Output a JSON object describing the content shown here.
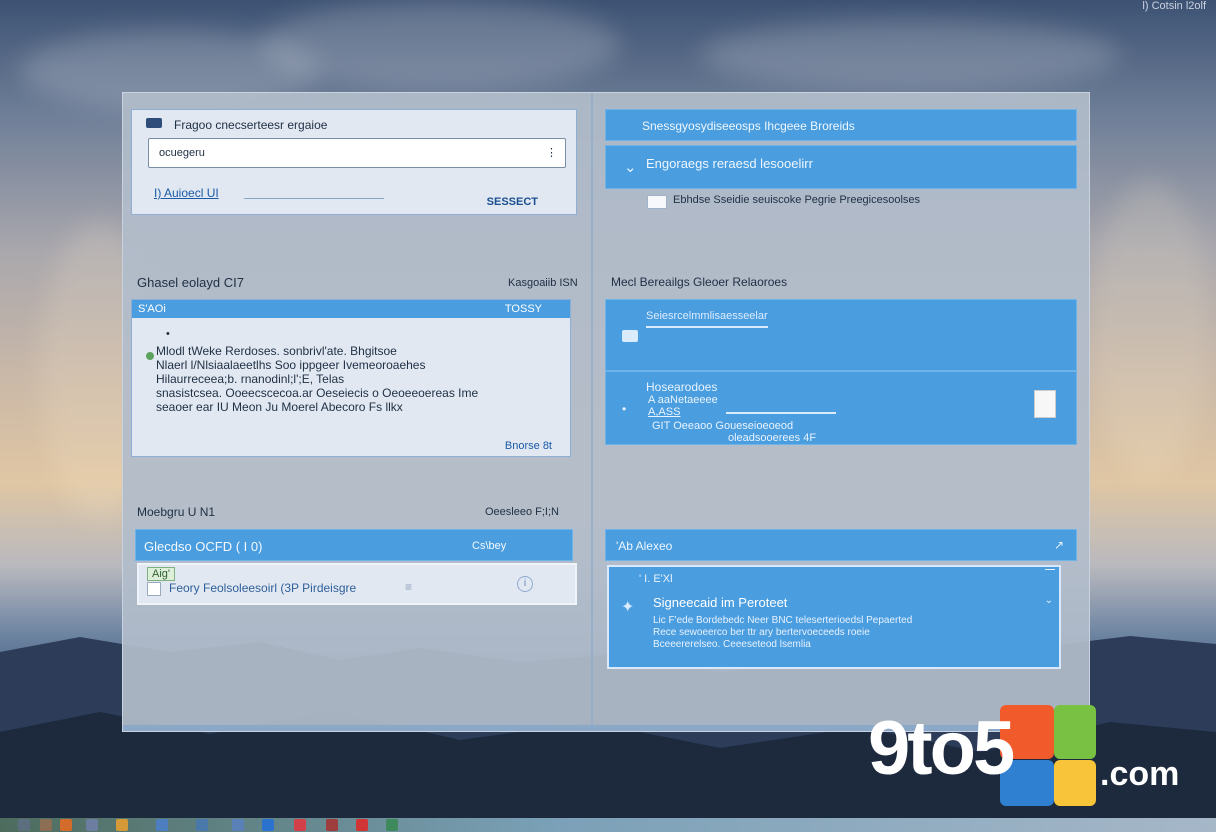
{
  "corner_text": "l) Cotsin l2olf",
  "left_pane": {
    "top_card": {
      "title": "Fragoo cnecserteesr ergaioe",
      "input_value": "ocuegeru",
      "link_text": "I) Auioecl  UI",
      "action_label": "SESSECT"
    },
    "section_one": {
      "title": "Ghasel eolayd CI7",
      "meta": "Kasgoaiib ISN",
      "card_header_left": "S'AOi",
      "card_header_right": "TOSSY",
      "card_mark": "•",
      "lines": [
        "Mlodl tWeke Rerdoses. sonbrivl'ate. Bhgitsoe",
        "Nlaerl l/Nlsiaalaeetlhs  Soo ippgeer Ivemeoroaehes",
        "Hilaurreceea;b. rnanodinl;l';E, Telas",
        "snasistcsea. Ooeecscecoa.ar Oeseiecis o Oeoeeoereas Ime",
        "seaoer ear IU Meon  Ju Moerel  Abecoro Fs llkx"
      ],
      "footer_right": "Bnorse 8t"
    },
    "section_two": {
      "title": "Moebgru U N1",
      "meta": "Oeesleeo F;I;N",
      "header_left": "Glecdso  OCFD  ( I 0)",
      "header_right": "Cs\\bey",
      "tag": "Aig'",
      "row_text": "Feory Feolsoleesoirl (3P Pirdeisgre"
    }
  },
  "right_pane": {
    "bar_one_text": "Snessgyosydiseeosps Ihcgeee Broreids",
    "bar_two_text": "Engoraegs reraesd lesooelirr",
    "checkbox_label": "Ebhdse Sseidie seuiscoke Pegrie Preegicesoolses",
    "section_title": "Mecl Bereailgs Gleoer Relaoroes",
    "blue_one_text": "Seiesrcelmmlisaesseelar",
    "blue_two": {
      "title": "Hosearodoes",
      "sub_one": "A aaNetaeeee",
      "sub_two": "A,ASS",
      "sub_three": "GIT Oeeaoo Goueseioeoeod",
      "sub_four": "oleadsooerees 4F"
    },
    "bottom": {
      "header": "'Ab Alexeo",
      "tag": "' I. E'Xl",
      "title": "Signeecaid im Peroteet",
      "lines": [
        "Lic F'ede Bordebedc Neer BNC teleserterioedsl Pepaerted",
        "Rece sewoeerco ber ttr ary bertervoeceeds roeie",
        "Bceeererelseo. Ceeeseteod lsemlia"
      ]
    }
  },
  "watermark": {
    "text": "9to5",
    "suffix": ".com"
  },
  "taskbar_icons": [
    "start-icon",
    "tag-icon",
    "flag-icon",
    "browser-icon",
    "chrome-icon",
    "folder-icon",
    "explorer-icon",
    "chat-icon",
    "ie-icon",
    "photos-icon",
    "spotify-icon",
    "red-icon",
    "google-icon"
  ],
  "colors": {
    "accent_blue": "#4a9ddf",
    "light_card": "#e1e8f1",
    "window_bg": "#b2bcca"
  }
}
